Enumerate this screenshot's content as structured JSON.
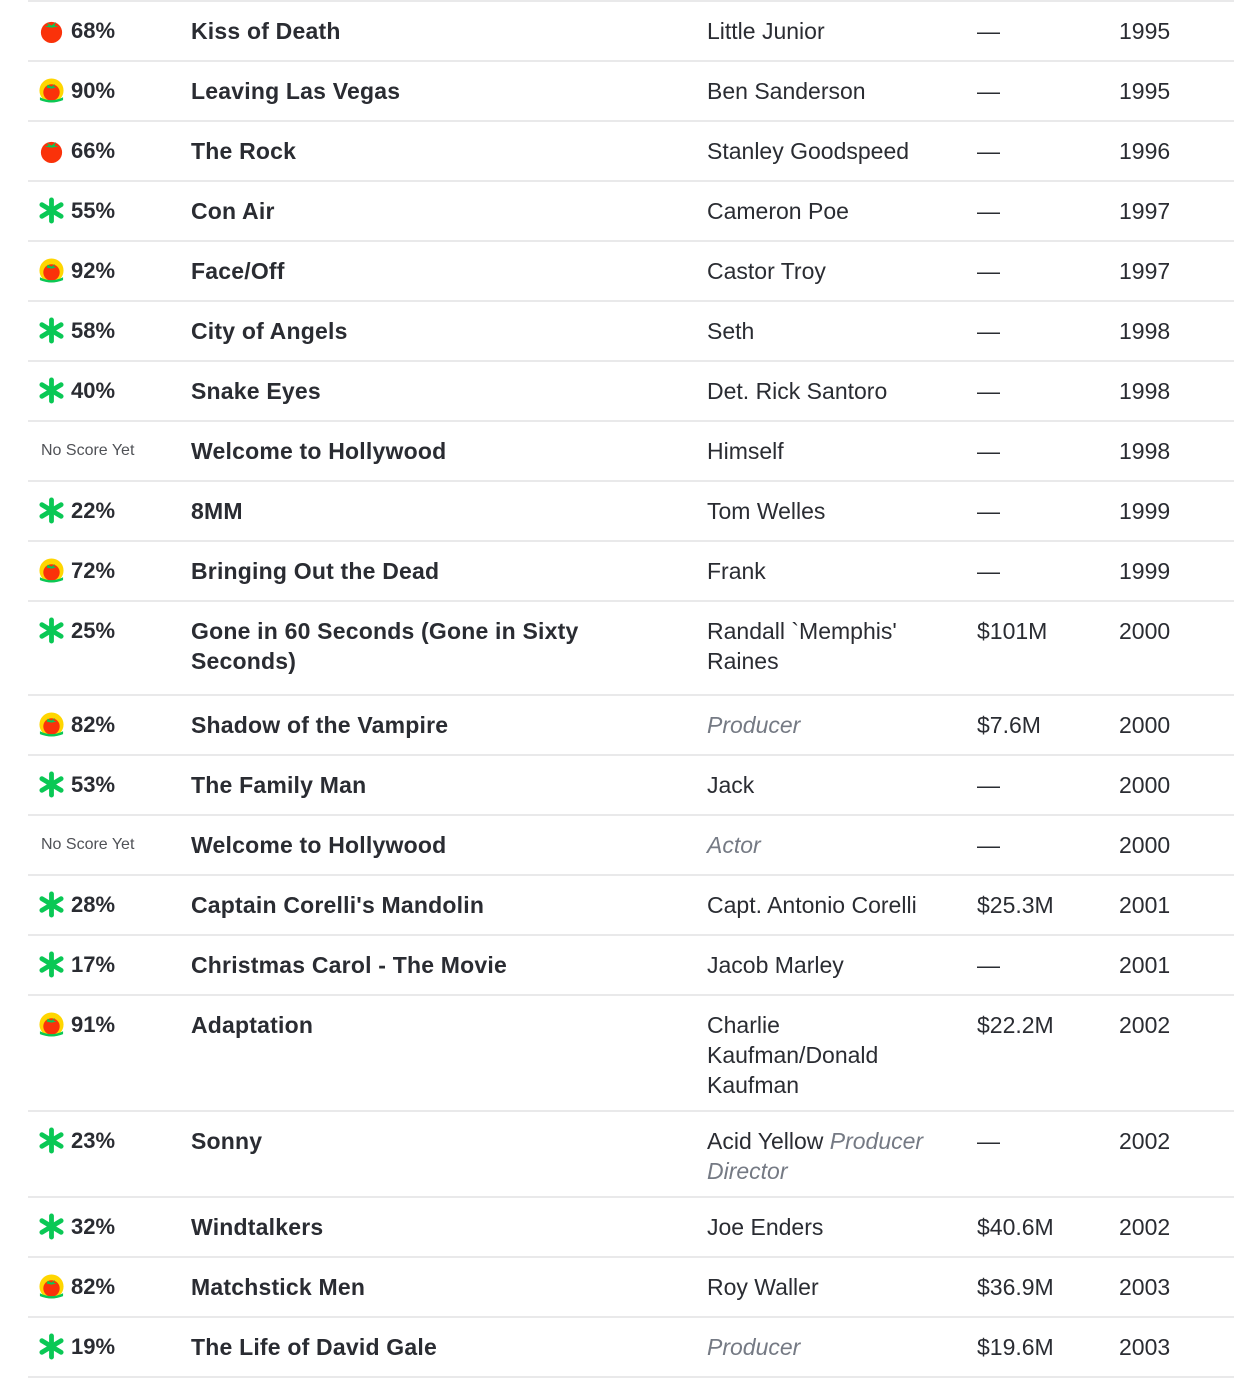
{
  "colors": {
    "fresh_red": "#fa320a",
    "certified_yellow": "#ffd600",
    "splat_green": "#0ac855",
    "divider": "#e9e9ea",
    "role_gray": "#757a84"
  },
  "rows": [
    {
      "score": "68%",
      "icon": "tomato-icon",
      "title": "Kiss of Death",
      "credit": "Little Junior",
      "credit_role": "",
      "box_office": "—",
      "year": "1995"
    },
    {
      "score": "90%",
      "icon": "certified-fresh-icon",
      "title": "Leaving Las Vegas",
      "credit": "Ben Sanderson",
      "credit_role": "",
      "box_office": "—",
      "year": "1995"
    },
    {
      "score": "66%",
      "icon": "tomato-icon",
      "title": "The Rock",
      "credit": "Stanley Goodspeed",
      "credit_role": "",
      "box_office": "—",
      "year": "1996"
    },
    {
      "score": "55%",
      "icon": "splat-icon",
      "title": "Con Air",
      "credit": "Cameron Poe",
      "credit_role": "",
      "box_office": "—",
      "year": "1997"
    },
    {
      "score": "92%",
      "icon": "certified-fresh-icon",
      "title": "Face/Off",
      "credit": "Castor Troy",
      "credit_role": "",
      "box_office": "—",
      "year": "1997"
    },
    {
      "score": "58%",
      "icon": "splat-icon",
      "title": "City of Angels",
      "credit": "Seth",
      "credit_role": "",
      "box_office": "—",
      "year": "1998"
    },
    {
      "score": "40%",
      "icon": "splat-icon",
      "title": "Snake Eyes",
      "credit": "Det. Rick Santoro",
      "credit_role": "",
      "box_office": "—",
      "year": "1998"
    },
    {
      "score": "No Score Yet",
      "icon": "",
      "title": "Welcome to Hollywood",
      "credit": "Himself",
      "credit_role": "",
      "box_office": "—",
      "year": "1998"
    },
    {
      "score": "22%",
      "icon": "splat-icon",
      "title": "8MM",
      "credit": "Tom Welles",
      "credit_role": "",
      "box_office": "—",
      "year": "1999"
    },
    {
      "score": "72%",
      "icon": "certified-fresh-icon",
      "title": "Bringing Out the Dead",
      "credit": "Frank",
      "credit_role": "",
      "box_office": "—",
      "year": "1999"
    },
    {
      "score": "25%",
      "icon": "splat-icon",
      "title": "Gone in 60 Seconds (Gone in Sixty Seconds)",
      "credit": "Randall `Memphis' Raines",
      "credit_role": "",
      "box_office": "$101M",
      "year": "2000"
    },
    {
      "score": "82%",
      "icon": "certified-fresh-icon",
      "title": "Shadow of the Vampire",
      "credit": "",
      "credit_role": "Producer",
      "box_office": "$7.6M",
      "year": "2000"
    },
    {
      "score": "53%",
      "icon": "splat-icon",
      "title": "The Family Man",
      "credit": "Jack",
      "credit_role": "",
      "box_office": "—",
      "year": "2000"
    },
    {
      "score": "No Score Yet",
      "icon": "",
      "title": "Welcome to Hollywood",
      "credit": "",
      "credit_role": "Actor",
      "box_office": "—",
      "year": "2000"
    },
    {
      "score": "28%",
      "icon": "splat-icon",
      "title": "Captain Corelli's Mandolin",
      "credit": "Capt. Antonio Corelli",
      "credit_role": "",
      "box_office": "$25.3M",
      "year": "2001"
    },
    {
      "score": "17%",
      "icon": "splat-icon",
      "title": "Christmas Carol - The Movie",
      "credit": "Jacob Marley",
      "credit_role": "",
      "box_office": "—",
      "year": "2001"
    },
    {
      "score": "91%",
      "icon": "certified-fresh-icon",
      "title": "Adaptation",
      "credit": "Charlie Kaufman/Donald Kaufman",
      "credit_role": "",
      "box_office": "$22.2M",
      "year": "2002"
    },
    {
      "score": "23%",
      "icon": "splat-icon",
      "title": "Sonny",
      "credit": "Acid Yellow",
      "credit_role": "Producer Director",
      "box_office": "—",
      "year": "2002"
    },
    {
      "score": "32%",
      "icon": "splat-icon",
      "title": "Windtalkers",
      "credit": "Joe Enders",
      "credit_role": "",
      "box_office": "$40.6M",
      "year": "2002"
    },
    {
      "score": "82%",
      "icon": "certified-fresh-icon",
      "title": "Matchstick Men",
      "credit": "Roy Waller",
      "credit_role": "",
      "box_office": "$36.9M",
      "year": "2003"
    },
    {
      "score": "19%",
      "icon": "splat-icon",
      "title": "The Life of David Gale",
      "credit": "",
      "credit_role": "Producer",
      "box_office": "$19.6M",
      "year": "2003"
    }
  ]
}
